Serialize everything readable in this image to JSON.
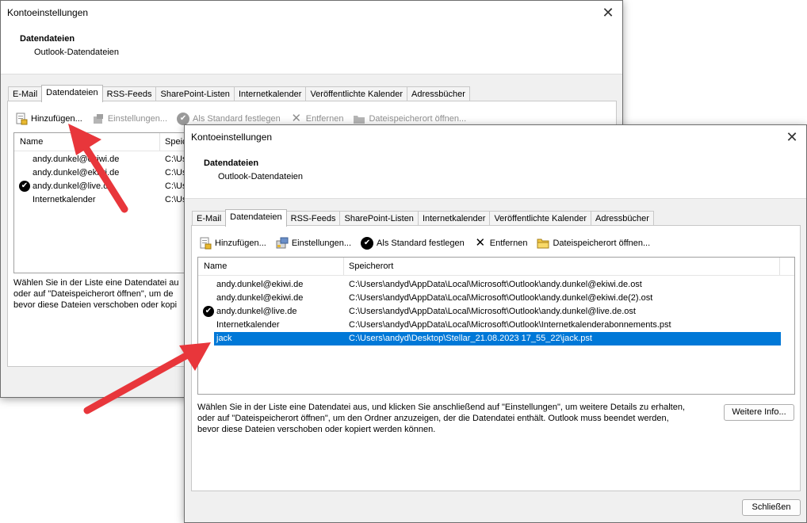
{
  "window_title": "Kontoeinstellungen",
  "header": {
    "title": "Datendateien",
    "subtitle": "Outlook-Datendateien"
  },
  "tabs": [
    "E-Mail",
    "Datendateien",
    "RSS-Feeds",
    "SharePoint-Listen",
    "Internetkalender",
    "Veröffentlichte Kalender",
    "Adressbücher"
  ],
  "active_tab": "Datendateien",
  "back_window": {
    "toolbar": {
      "add": "Hinzufügen...",
      "settings": "Einstellungen...",
      "default": "Als Standard festlegen",
      "remove": "Entfernen",
      "open_location": "Dateispeicherort öffnen..."
    },
    "columns": {
      "name": "Name",
      "location": "Speich"
    },
    "rows": [
      {
        "name": "andy.dunkel@ekiwi.de",
        "location": "C:\\Us"
      },
      {
        "name": "andy.dunkel@ekiwi.de",
        "location": "C:\\Us"
      },
      {
        "name": "andy.dunkel@live.de",
        "location": "C:\\Us",
        "default": true
      },
      {
        "name": "Internetkalender",
        "location": "C:\\Us"
      }
    ],
    "info_lines": [
      "Wählen Sie in der Liste eine Datendatei au",
      "oder auf \"Dateispeicherort öffnen\", um de",
      "bevor diese Dateien verschoben oder kopi"
    ]
  },
  "front_window": {
    "toolbar": {
      "add": "Hinzufügen...",
      "settings": "Einstellungen...",
      "default": "Als Standard festlegen",
      "remove": "Entfernen",
      "open_location": "Dateispeicherort öffnen..."
    },
    "columns": {
      "name": "Name",
      "location": "Speicherort"
    },
    "rows": [
      {
        "name": "andy.dunkel@ekiwi.de",
        "location": "C:\\Users\\andyd\\AppData\\Local\\Microsoft\\Outlook\\andy.dunkel@ekiwi.de.ost"
      },
      {
        "name": "andy.dunkel@ekiwi.de",
        "location": "C:\\Users\\andyd\\AppData\\Local\\Microsoft\\Outlook\\andy.dunkel@ekiwi.de(2).ost"
      },
      {
        "name": "andy.dunkel@live.de",
        "location": "C:\\Users\\andyd\\AppData\\Local\\Microsoft\\Outlook\\andy.dunkel@live.de.ost",
        "default": true
      },
      {
        "name": "Internetkalender",
        "location": "C:\\Users\\andyd\\AppData\\Local\\Microsoft\\Outlook\\Internetkalenderabonnements.pst"
      },
      {
        "name": "jack",
        "location": "C:\\Users\\andyd\\Desktop\\Stellar_21.08.2023 17_55_22\\jack.pst",
        "selected": true
      }
    ],
    "info_lines": [
      "Wählen Sie in der Liste eine Datendatei aus, und klicken Sie anschließend auf \"Einstellungen\", um weitere Details zu erhalten,",
      "oder auf \"Dateispeicherort öffnen\", um den Ordner anzuzeigen, der die Datendatei enthält. Outlook muss beendet werden,",
      "bevor diese Dateien verschoben oder kopiert werden können."
    ],
    "more_info_button": "Weitere Info...",
    "close_button": "Schließen"
  },
  "colors": {
    "selection": "#0078d7",
    "arrow": "#e8363b"
  },
  "icons": [
    "add-datafile-icon",
    "settings-icon",
    "checkmark-icon",
    "remove-x-icon",
    "folder-icon",
    "close-icon"
  ]
}
